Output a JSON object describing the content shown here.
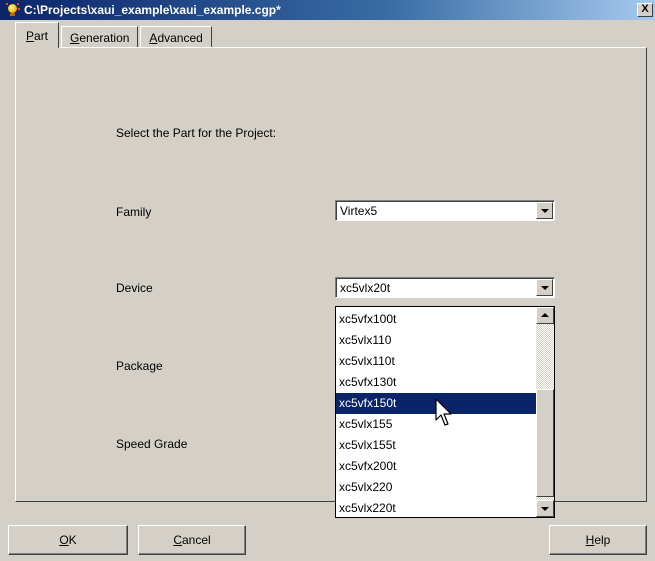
{
  "window": {
    "title": "C:\\Projects\\xaui_example\\xaui_example.cgp*",
    "close_label": "X"
  },
  "tabs": [
    {
      "label": "Part",
      "mnemonic_index": 0,
      "active": true
    },
    {
      "label": "Generation",
      "mnemonic_index": 0,
      "active": false
    },
    {
      "label": "Advanced",
      "mnemonic_index": 0,
      "active": false
    }
  ],
  "part": {
    "heading": "Select the Part for the Project:",
    "family": {
      "label": "Family",
      "value": "Virtex5"
    },
    "device": {
      "label": "Device",
      "value": "xc5vlx20t"
    },
    "package": {
      "label": "Package"
    },
    "speed_grade": {
      "label": "Speed Grade"
    }
  },
  "device_dropdown": {
    "items": [
      "xc5vfx100t",
      "xc5vlx110",
      "xc5vlx110t",
      "xc5vfx130t",
      "xc5vfx150t",
      "xc5vlx155",
      "xc5vlx155t",
      "xc5vfx200t",
      "xc5vlx220",
      "xc5vlx220t"
    ],
    "highlighted_index": 4
  },
  "buttons": {
    "ok": "OK",
    "cancel": "Cancel",
    "help": "Help"
  },
  "icons": {
    "app": "lightbulb-icon",
    "cursor": "mouse-pointer-icon"
  }
}
